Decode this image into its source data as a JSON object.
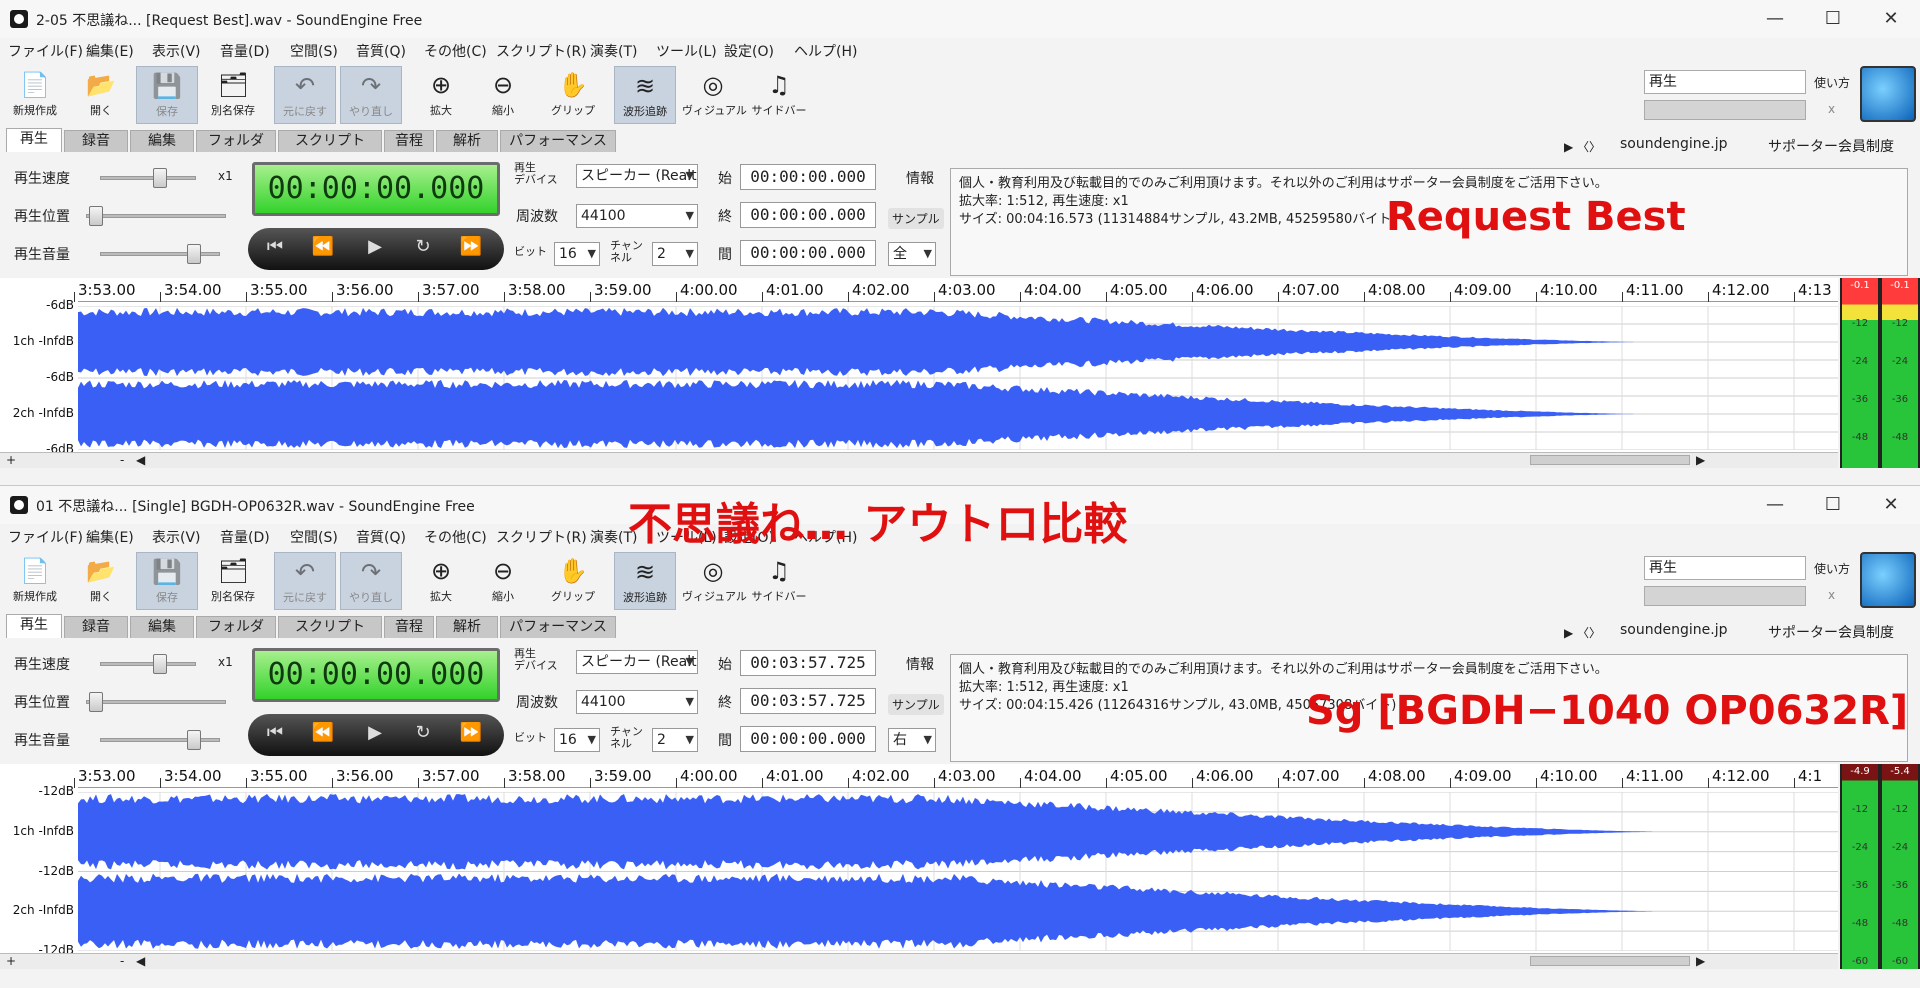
{
  "windows": [
    {
      "title": "2-05 不思議ね... [Request Best].wav - SoundEngine Free",
      "menu": [
        "ファイル(F)",
        "編集(E)",
        "表示(V)",
        "音量(D)",
        "空間(S)",
        "音質(Q)",
        "その他(C)",
        "スクリプト(R)",
        "演奏(T)",
        "ツール(L)",
        "設定(O)",
        "ヘルプ(H)"
      ],
      "toolbar": [
        "新規作成",
        "開く",
        "保存",
        "別名保存",
        "元に戻す",
        "やり直し",
        "拡大",
        "縮小",
        "グリップ",
        "波形追跡",
        "ヴィジュアル",
        "サイドバー"
      ],
      "tabs": [
        "再生",
        "録音",
        "編集",
        "フォルダ",
        "スクリプト",
        "音程",
        "解析",
        "パフォーマンス"
      ],
      "speed_label": "再生速度",
      "position_label": "再生位置",
      "volume_label": "再生音量",
      "speed_value": "x1",
      "time_display": "00:00:00.000",
      "device_label": "再生\nデバイス",
      "device_value": "スピーカー (Realt",
      "freq_label": "周波数",
      "freq_value": "44100",
      "bit_label": "ビット",
      "bit_value": "16",
      "chan_label": "チャン\nネル",
      "chan_value": "2",
      "start_label": "始",
      "start_value": "00:00:00.000",
      "end_label": "終",
      "end_value": "00:00:00.000",
      "span_label": "間",
      "span_value": "00:00:00.000",
      "info_label": "情報",
      "sample_label": "サンプル",
      "range_value": "全",
      "info_lines": [
        "個人・教育利用及び転載目的でのみご利用頂けます。それ以外のご利用はサポーター会員制度をご活用下さい。",
        "拡大率: 1:512, 再生速度: x1",
        "サイズ: 00:04:16.573 (11314884サンプル, 43.2MB, 45259580バイト)"
      ],
      "search_value": "再生",
      "help_label": "使い方",
      "close_x": "x",
      "link1": "soundengine.jp",
      "link2": "サポーター会員制度",
      "ruler": [
        "3:53.00",
        "3:54.00",
        "3:55.00",
        "3:56.00",
        "3:57.00",
        "3:58.00",
        "3:59.00",
        "4:00.00",
        "4:01.00",
        "4:02.00",
        "4:03.00",
        "4:04.00",
        "4:05.00",
        "4:06.00",
        "4:07.00",
        "4:08.00",
        "4:09.00",
        "4:10.00",
        "4:11.00",
        "4:12.00",
        "4:13"
      ],
      "db_labels": [
        "-6dB",
        "1ch -InfdB",
        "-6dB",
        "2ch -InfdB",
        "-6dB"
      ],
      "meter_top": [
        "-0.1",
        "-0.1"
      ],
      "meter_scale": [
        "-12",
        "-24",
        "-36",
        "-48"
      ],
      "overlay": "Request Best"
    },
    {
      "title": "01 不思議ね... [Single] BGDH-OP0632R.wav - SoundEngine Free",
      "menu": [
        "ファイル(F)",
        "編集(E)",
        "表示(V)",
        "音量(D)",
        "空間(S)",
        "音質(Q)",
        "その他(C)",
        "スクリプト(R)",
        "演奏(T)",
        "ツール(L)",
        "設定(O)",
        "ヘルプ(H)"
      ],
      "toolbar": [
        "新規作成",
        "開く",
        "保存",
        "別名保存",
        "元に戻す",
        "やり直し",
        "拡大",
        "縮小",
        "グリップ",
        "波形追跡",
        "ヴィジュアル",
        "サイドバー"
      ],
      "tabs": [
        "再生",
        "録音",
        "編集",
        "フォルダ",
        "スクリプト",
        "音程",
        "解析",
        "パフォーマンス"
      ],
      "speed_label": "再生速度",
      "position_label": "再生位置",
      "volume_label": "再生音量",
      "speed_value": "x1",
      "time_display": "00:00:00.000",
      "device_label": "再生\nデバイス",
      "device_value": "スピーカー (Realt",
      "freq_label": "周波数",
      "freq_value": "44100",
      "bit_label": "ビット",
      "bit_value": "16",
      "chan_label": "チャン\nネル",
      "chan_value": "2",
      "start_label": "始",
      "start_value": "00:03:57.725",
      "end_label": "終",
      "end_value": "00:03:57.725",
      "span_label": "間",
      "span_value": "00:00:00.000",
      "info_label": "情報",
      "sample_label": "サンプル",
      "range_value": "右",
      "info_lines": [
        "個人・教育利用及び転載目的でのみご利用頂けます。それ以外のご利用はサポーター会員制度をご活用下さい。",
        "拡大率: 1:512, 再生速度: x1",
        "サイズ: 00:04:15.426 (11264316サンプル, 43.0MB, 45057308バイト)"
      ],
      "search_value": "再生",
      "help_label": "使い方",
      "close_x": "x",
      "link1": "soundengine.jp",
      "link2": "サポーター会員制度",
      "ruler": [
        "3:53.00",
        "3:54.00",
        "3:55.00",
        "3:56.00",
        "3:57.00",
        "3:58.00",
        "3:59.00",
        "4:00.00",
        "4:01.00",
        "4:02.00",
        "4:03.00",
        "4:04.00",
        "4:05.00",
        "4:06.00",
        "4:07.00",
        "4:08.00",
        "4:09.00",
        "4:10.00",
        "4:11.00",
        "4:12.00",
        "4:1"
      ],
      "db_labels": [
        "-12dB",
        "1ch -InfdB",
        "-12dB",
        "2ch -InfdB",
        "-12dB"
      ],
      "meter_top": [
        "-4.9",
        "-5.4"
      ],
      "meter_scale": [
        "-12",
        "-24",
        "-36",
        "-48",
        "-60"
      ],
      "overlay": "Sg [BGDH−1040 OP0632R]"
    }
  ],
  "center_overlay": "不思議ね… アウトロ比較",
  "colors": {
    "waveform": "#3a5ff5",
    "lcd": "#4edb3a",
    "overlay": "#e01010",
    "meter": "#28c43a"
  }
}
